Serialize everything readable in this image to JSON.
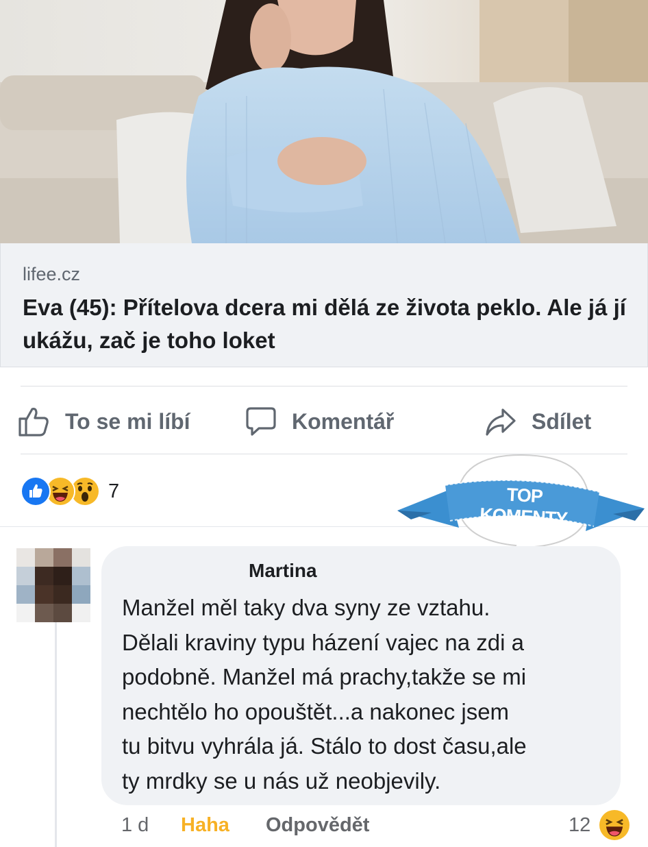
{
  "link": {
    "domain": "lifee.cz",
    "title": "Eva (45): Přítelova dcera mi dělá ze života peklo. Ale já jí ukážu, zač je toho loket"
  },
  "actions": {
    "like": "To se mi líbí",
    "comment": "Komentář",
    "share": "Sdílet"
  },
  "reactions": {
    "icons": [
      "like-icon",
      "haha-icon",
      "wow-icon"
    ],
    "count": "7"
  },
  "badge": {
    "label": "TOP KOMENTY"
  },
  "comment": {
    "author": "Martina",
    "text": "Manžel měl taky dva syny ze vztahu.\nDělali kraviny typu házení vajec na zdi a\npodobně. Manžel má prachy,takže se mi\nnechtělo ho  opouštět...a nakonec jsem\ntu bitvu vyhrála já. Stálo to dost času,ale\nty mrdky se u nás už neobjevily.",
    "time": "1 d",
    "reaction_label": "Haha",
    "reply_label": "Odpovědět",
    "reaction_count": "12"
  },
  "colors": {
    "background": "#ffffff",
    "card": "#f0f2f5",
    "meta_text": "#606770",
    "haha": "#f7b125",
    "badge_ribbon": "#3b8fd0",
    "like_blue": "#1877f2"
  }
}
